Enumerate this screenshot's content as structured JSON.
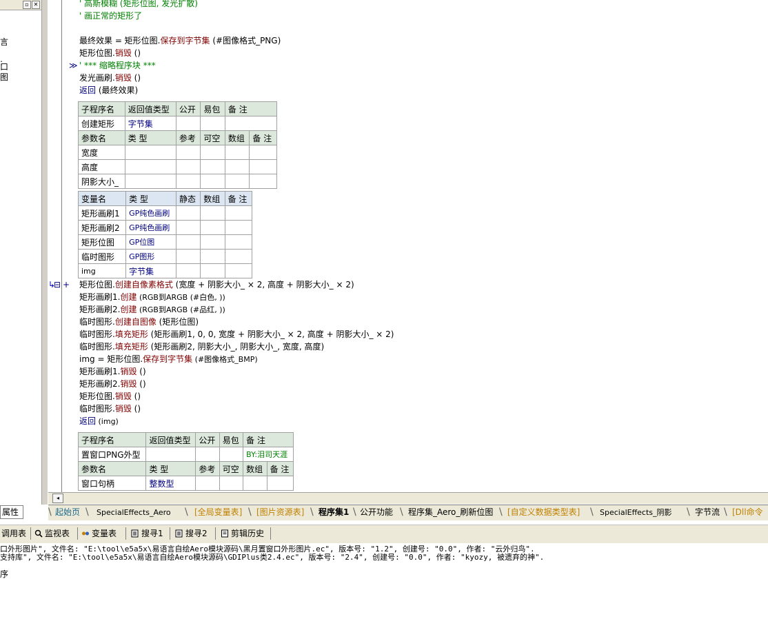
{
  "left_panel": {
    "fragments": [
      "言",
      ":",
      "口",
      "图"
    ],
    "properties_tab": "属性"
  },
  "code_top": [
    {
      "text": "' 高斯模糊 (矩形位图, 发光扩散)",
      "kind": "cmt"
    },
    {
      "text": "' 画正常的矩形了",
      "kind": "cmt"
    }
  ],
  "code_block1": {
    "line1_a": "最终效果 = 矩形位图.",
    "line1_kw": "保存到字节集",
    "line1_b": " (#图像格式_PNG)",
    "line2_a": "矩形位图.",
    "line2_kw": "销毁",
    "line2_b": " ()",
    "line3": "' *** 缩略程序块 ***",
    "line4_a": "发光画刷.",
    "line4_kw": "销毁",
    "line4_b": " ()",
    "line5_kw": "返回",
    "line5_b": " (最终效果)"
  },
  "sub1": {
    "header": [
      "子程序名",
      "返回值类型",
      "公开",
      "易包",
      "备 注"
    ],
    "row": [
      "创建矩形",
      "字节集",
      "",
      "",
      ""
    ],
    "param_header": [
      "参数名",
      "类 型",
      "参考",
      "可空",
      "数组",
      "备 注"
    ],
    "params": [
      "宽度",
      "高度",
      "阴影大小_"
    ]
  },
  "vars1": {
    "header": [
      "变量名",
      "类 型",
      "静态",
      "数组",
      "备 注"
    ],
    "rows": [
      [
        "矩形画刷1",
        "GP纯色画刷"
      ],
      [
        "矩形画刷2",
        "GP纯色画刷"
      ],
      [
        "矩形位图",
        "GP位图"
      ],
      [
        "临时图形",
        "GP图形"
      ],
      [
        "img",
        "字节集"
      ]
    ]
  },
  "code_block2": [
    {
      "obj": "矩形位图.",
      "kw": "创建自像素格式",
      "args": " (宽度 + 阴影大小_ × 2, 高度 + 阴影大小_ × 2)"
    },
    {
      "obj": "矩形画刷1.",
      "kw": "创建",
      "args": " (RGB到ARGB (#白色, ))"
    },
    {
      "obj": "矩形画刷2.",
      "kw": "创建",
      "args": " (RGB到ARGB (#品红, ))"
    },
    {
      "obj": "临时图形.",
      "kw": "创建自图像",
      "args": " (矩形位图)"
    },
    {
      "obj": "临时图形.",
      "kw": "填充矩形",
      "args": " (矩形画刷1, 0, 0, 宽度 + 阴影大小_ × 2, 高度 + 阴影大小_ × 2)"
    },
    {
      "obj": "临时图形.",
      "kw": "填充矩形",
      "args": " (矩形画刷2, 阴影大小_, 阴影大小_, 宽度, 高度)"
    },
    {
      "obj": "img = 矩形位图.",
      "kw": "保存到字节集",
      "args": " (#图像格式_BMP)"
    },
    {
      "obj": "矩形画刷1.",
      "kw": "销毁",
      "args": " ()"
    },
    {
      "obj": "矩形画刷2.",
      "kw": "销毁",
      "args": " ()"
    },
    {
      "obj": "矩形位图.",
      "kw": "销毁",
      "args": " ()"
    },
    {
      "obj": "临时图形.",
      "kw": "销毁",
      "args": " ()"
    },
    {
      "obj": "",
      "kw": "返回",
      "args": " (img)"
    }
  ],
  "sub2": {
    "header": [
      "子程序名",
      "返回值类型",
      "公开",
      "易包",
      "备 注"
    ],
    "row": [
      "置窗口PNG外型",
      "",
      "",
      "",
      "BY:泪司天涯"
    ],
    "param_header": [
      "参数名",
      "类 型",
      "参考",
      "可空",
      "数组",
      "备 注"
    ],
    "params": [
      [
        "窗口句柄",
        "整数型"
      ]
    ]
  },
  "tabs": [
    {
      "label": "起始页",
      "style": "teal"
    },
    {
      "label": "SpecialEffects_Aero",
      "style": ""
    },
    {
      "label": "[全局变量表]",
      "style": "orange"
    },
    {
      "label": "[图片资源表]",
      "style": "orange"
    },
    {
      "label": "程序集1",
      "style": "active"
    },
    {
      "label": "公开功能",
      "style": ""
    },
    {
      "label": "程序集_Aero_刷新位图",
      "style": ""
    },
    {
      "label": "[自定义数据类型表]",
      "style": "orange"
    },
    {
      "label": "SpecialEffects_阴影",
      "style": ""
    },
    {
      "label": "字节流",
      "style": ""
    },
    {
      "label": "[Dll命令",
      "style": "orange"
    }
  ],
  "tool_tabs": [
    {
      "label": "调用表",
      "icon": "call-table-icon"
    },
    {
      "label": "监视表",
      "icon": "magnifier-icon"
    },
    {
      "label": "变量表",
      "icon": "variables-icon"
    },
    {
      "label": "搜寻1",
      "icon": "search-doc-icon"
    },
    {
      "label": "搜寻2",
      "icon": "search-doc-icon"
    },
    {
      "label": "剪辑历史",
      "icon": "clipboard-icon"
    }
  ],
  "output": [
    "口外形图片\", 文件名: \"E:\\tool\\e5a5x\\易语言自绘Aero模块源码\\黑月置窗口外形图片.ec\", 版本号: \"1.2\", 创建号: \"0.0\", 作者: \"云外归鸟\".",
    "支持库\", 文件名: \"E:\\tool\\e5a5x\\易语言自绘Aero模块源码\\GDIPlus类2.4.ec\", 版本号: \"2.4\", 创建号: \"0.0\", 作者: \"kyozy, 被遗弃的神\".",
    "",
    "序"
  ]
}
